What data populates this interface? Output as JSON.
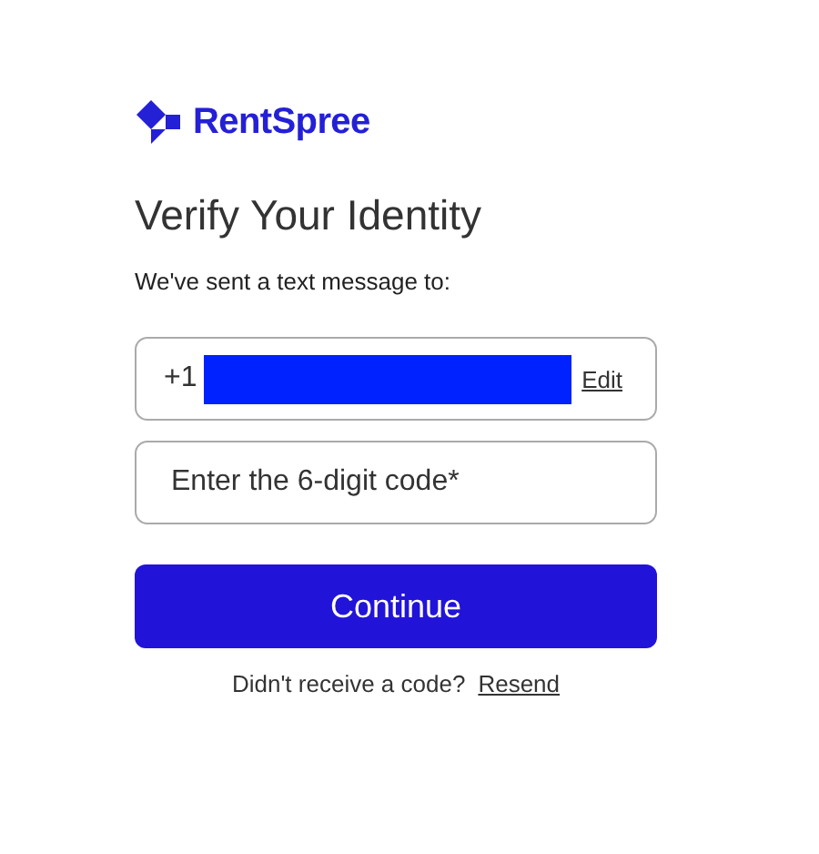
{
  "logo": {
    "text": "RentSpree"
  },
  "title": "Verify Your Identity",
  "message": "We've sent a text message to:",
  "phone": {
    "prefix": "+1",
    "edit": "Edit"
  },
  "code_field": {
    "placeholder": "Enter the 6-digit code*"
  },
  "continue_button": "Continue",
  "resend": {
    "prompt": "Didn't receive a code?",
    "link": "Resend"
  }
}
